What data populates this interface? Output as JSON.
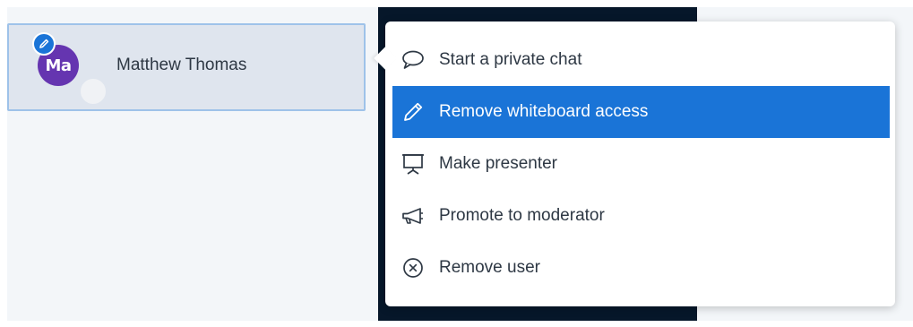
{
  "user": {
    "name": "Matthew Thomas",
    "initials": "Ma"
  },
  "menu": {
    "items": [
      {
        "label": "Start a private chat",
        "icon": "chat-bubble-icon"
      },
      {
        "label": "Remove whiteboard access",
        "icon": "pencil-icon"
      },
      {
        "label": "Make presenter",
        "icon": "presentation-screen-icon"
      },
      {
        "label": "Promote to moderator",
        "icon": "megaphone-icon"
      },
      {
        "label": "Remove user",
        "icon": "close-circle-icon"
      }
    ],
    "highlighted_index": 1
  },
  "colors": {
    "avatar": "#6535b0",
    "accent": "#1a74d7",
    "dark_panel": "#06172a"
  }
}
